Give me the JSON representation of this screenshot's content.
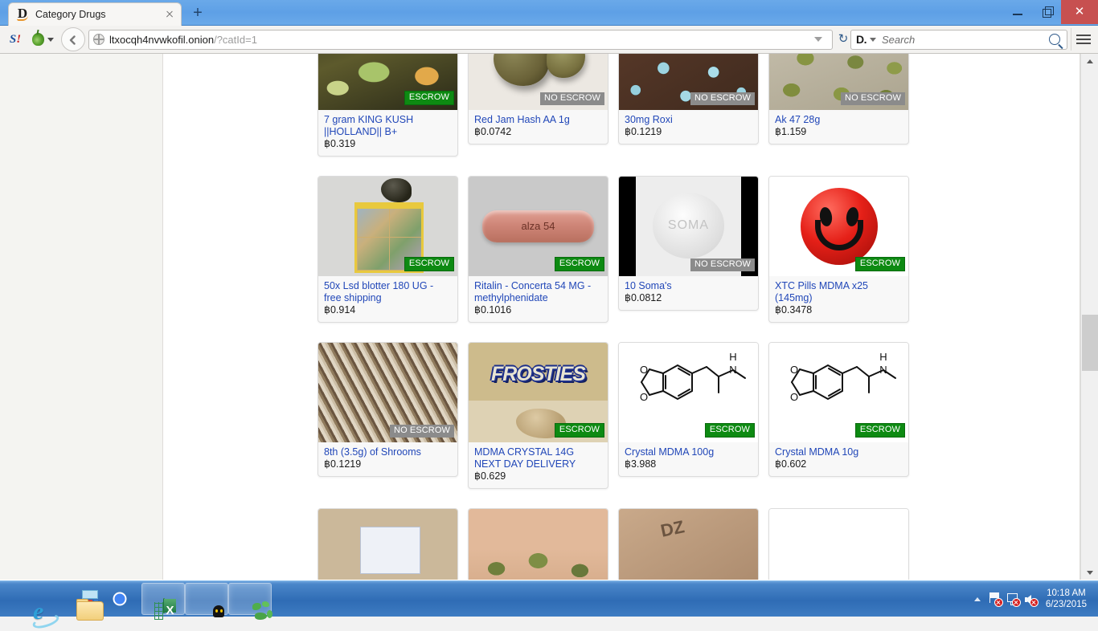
{
  "window": {
    "tab_title": "Category Drugs",
    "tab_favicon": "D",
    "newtab_label": "+",
    "minimize_label": "–",
    "maximize_label": "□",
    "close_label": "✕"
  },
  "toolbar": {
    "scriptish_icon": "S!",
    "torbutton_icon": "onion-icon",
    "back_label": "←",
    "url_host": "ltxocqh4nvwkofil.onion",
    "url_path": "/?catId=1",
    "reload_label": "↻",
    "search_engine": "D.",
    "search_placeholder": "Search",
    "menu_label": "≡"
  },
  "listing": {
    "rows": [
      [
        {
          "title": "7 gram KING KUSH ||HOLLAND|| B+",
          "price": "฿0.319",
          "escrow": "ESCROW",
          "escrow_type": "escrow",
          "image": "ph-kush",
          "image_alt": "cannabis-buds-photo"
        },
        {
          "title": "Red Jam Hash AA 1g",
          "price": "฿0.0742",
          "escrow": "NO ESCROW",
          "escrow_type": "noescrow",
          "image": "ph-hash",
          "image_alt": "hash-balls-photo"
        },
        {
          "title": "30mg Roxi",
          "price": "฿0.1219",
          "escrow": "NO ESCROW",
          "escrow_type": "noescrow",
          "image": "ph-roxi",
          "image_alt": "blue-pills-photo"
        },
        {
          "title": "Ak 47 28g",
          "price": "฿1.159",
          "escrow": "NO ESCROW",
          "escrow_type": "noescrow",
          "image": "ph-ak47",
          "image_alt": "cannabis-pile-photo"
        }
      ],
      [
        {
          "title": "50x Lsd blotter 180 UG - free shipping",
          "price": "฿0.914",
          "escrow": "ESCROW",
          "escrow_type": "escrow",
          "image": "ph-lsd",
          "image_alt": "lsd-blotter-sheet-photo"
        },
        {
          "title": "Ritalin - Concerta 54 MG - methylphenidate",
          "price": "฿0.1016",
          "escrow": "ESCROW",
          "escrow_type": "escrow",
          "image": "ph-alza",
          "image_alt": "alza-54-pill-photo"
        },
        {
          "title": "10 Soma's",
          "price": "฿0.0812",
          "escrow": "NO ESCROW",
          "escrow_type": "noescrow",
          "image": "ph-soma",
          "image_alt": "soma-tablet-photo"
        },
        {
          "title": "XTC Pills MDMA x25 (145mg)",
          "price": "฿0.3478",
          "escrow": "ESCROW",
          "escrow_type": "escrow",
          "image": "ph-smiley",
          "image_alt": "red-smiley-face-logo"
        }
      ],
      [
        {
          "title": "8th (3.5g) of Shrooms",
          "price": "฿0.1219",
          "escrow": "NO ESCROW",
          "escrow_type": "noescrow",
          "image": "ph-shrooms",
          "image_alt": "dried-mushrooms-photo"
        },
        {
          "title": "MDMA CRYSTAL 14G NEXT DAY DELIVERY",
          "price": "฿0.629",
          "escrow": "ESCROW",
          "escrow_type": "escrow",
          "image": "ph-frosties",
          "image_alt": "frosties-box-photo"
        },
        {
          "title": "Crystal MDMA 100g",
          "price": "฿3.988",
          "escrow": "ESCROW",
          "escrow_type": "escrow",
          "image": "ph-mdma",
          "image_alt": "mdma-chemical-structure-diagram"
        },
        {
          "title": "Crystal MDMA 10g",
          "price": "฿0.602",
          "escrow": "ESCROW",
          "escrow_type": "escrow",
          "image": "ph-mdma",
          "image_alt": "mdma-chemical-structure-diagram"
        }
      ],
      [
        {
          "title": "",
          "price": "",
          "escrow": "",
          "escrow_type": "",
          "image": "ph-gen1",
          "image_alt": "packaged-item-photo"
        },
        {
          "title": "",
          "price": "",
          "escrow": "",
          "escrow_type": "",
          "image": "ph-gen2",
          "image_alt": "cannabis-buds-photo"
        },
        {
          "title": "",
          "price": "",
          "escrow": "",
          "escrow_type": "",
          "image": "ph-gen3",
          "image_alt": "labelled-package-photo"
        },
        {
          "title": "",
          "price": "",
          "escrow": "",
          "escrow_type": "",
          "image": "ph-gen4",
          "image_alt": "white-product-photo"
        }
      ]
    ]
  },
  "taskbar": {
    "buttons": [
      {
        "name": "internet-explorer",
        "icon": "ie-icon",
        "active": false
      },
      {
        "name": "file-explorer",
        "icon": "folder-icon",
        "active": false
      },
      {
        "name": "google-chrome",
        "icon": "chrome-icon",
        "active": false
      },
      {
        "name": "microsoft-excel",
        "icon": "excel-icon",
        "active": true
      },
      {
        "name": "cyberghost-vpn",
        "icon": "ghost-icon",
        "active": true
      },
      {
        "name": "tor-browser",
        "icon": "globe-icon",
        "active": true
      }
    ],
    "tray": {
      "show_hidden_label": "▲",
      "action_center": "flag-icon",
      "network": "network-icon",
      "volume": "speaker-muted-icon",
      "time": "10:18 AM",
      "date": "6/23/2015"
    }
  },
  "colors": {
    "escrow_green": "#0d8a12",
    "no_escrow_gray": "#8b8b8b",
    "link_blue": "#2147b8",
    "titlebar_blue": "#6aa9e9",
    "close_red": "#c75050"
  }
}
